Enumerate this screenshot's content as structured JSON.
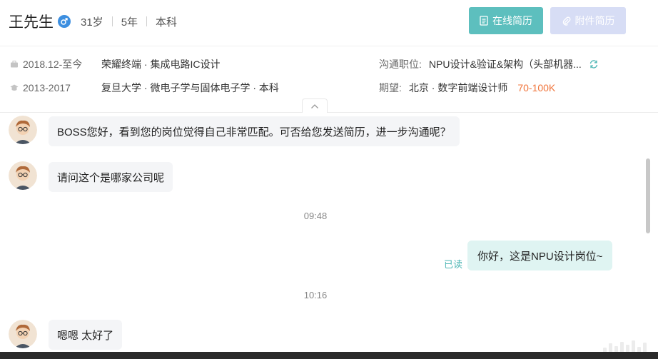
{
  "header": {
    "name": "王先生",
    "age": "31岁",
    "experience": "5年",
    "education": "本科",
    "btn_resume": "在线简历",
    "btn_attachment": "附件简历"
  },
  "work": {
    "dates": "2018.12-至今",
    "org": "荣耀终端 · 集成电路IC设计"
  },
  "school": {
    "dates": "2013-2017",
    "org": "复旦大学 · 微电子学与固体电子学 · 本科"
  },
  "position": {
    "label": "沟通职位:",
    "value": "NPU设计&验证&架构（头部机器..."
  },
  "expect": {
    "label": "期望:",
    "value": "北京 · 数字前端设计师",
    "salary": "70-100K"
  },
  "messages": {
    "m1": "BOSS您好，看到您的岗位觉得自己非常匹配。可否给您发送简历，进一步沟通呢？",
    "m2": "请问这个是哪家公司呢",
    "t1": "09:48",
    "m3": "你好，这是NPU设计岗位~",
    "read": "已读",
    "t2": "10:16",
    "m4": "嗯嗯 太好了"
  },
  "colors": {
    "accent": "#5dbfbe",
    "salary": "#f0743a",
    "out_bubble": "#dff4f2"
  }
}
